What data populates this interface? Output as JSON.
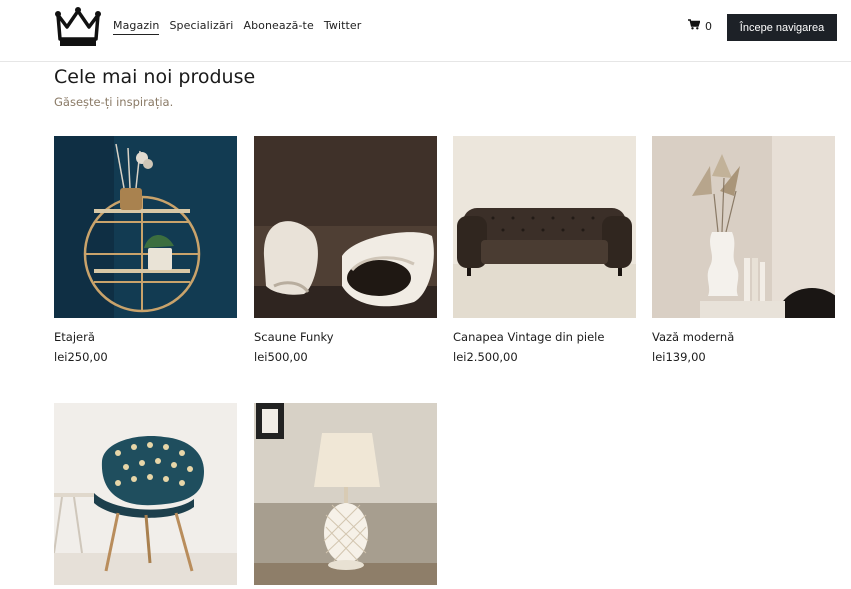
{
  "header": {
    "logo_icon": "crown-icon",
    "nav": [
      {
        "label": "Magazin",
        "active": true
      },
      {
        "label": "Specializări",
        "active": false
      },
      {
        "label": "Abonează-te",
        "active": false
      },
      {
        "label": "Twitter",
        "active": false
      }
    ],
    "cart_icon": "cart-icon",
    "cart_count": "0",
    "cta_label": "Începe navigarea"
  },
  "main": {
    "title": "Cele mai noi produse",
    "subtitle": "Găsește-ți inspirația."
  },
  "products": [
    {
      "name": "Etajeră",
      "price": "lei250,00"
    },
    {
      "name": "Scaune Funky",
      "price": "lei500,00"
    },
    {
      "name": "Canapea Vintage din piele",
      "price": "lei2.500,00"
    },
    {
      "name": "Vază modernă",
      "price": "lei139,00"
    },
    {
      "name": "",
      "price": ""
    },
    {
      "name": "",
      "price": ""
    }
  ],
  "colors": {
    "cta_bg": "#1d2127",
    "subtitle": "#8a7a66",
    "border": "#e6e6e6"
  }
}
